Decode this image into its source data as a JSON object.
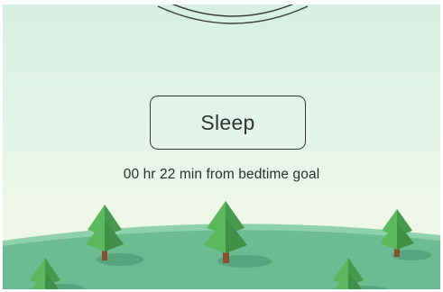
{
  "sleep_button": {
    "label": "Sleep"
  },
  "status": {
    "bedtime_goal_text": "00 hr 22 min from bedtime goal"
  },
  "colors": {
    "sky_top": "#d7f0e3",
    "sky_bottom": "#f1f6e4",
    "hill": "#6fbf96",
    "hill_far": "#8ccfa6",
    "tree_light": "#5cb85c",
    "tree_dark": "#3f8f46",
    "trunk": "#8a4f2a",
    "outline": "#333a36"
  },
  "icons": {
    "decor": "concentric-arcs-icon",
    "trees": "tree-icon"
  }
}
